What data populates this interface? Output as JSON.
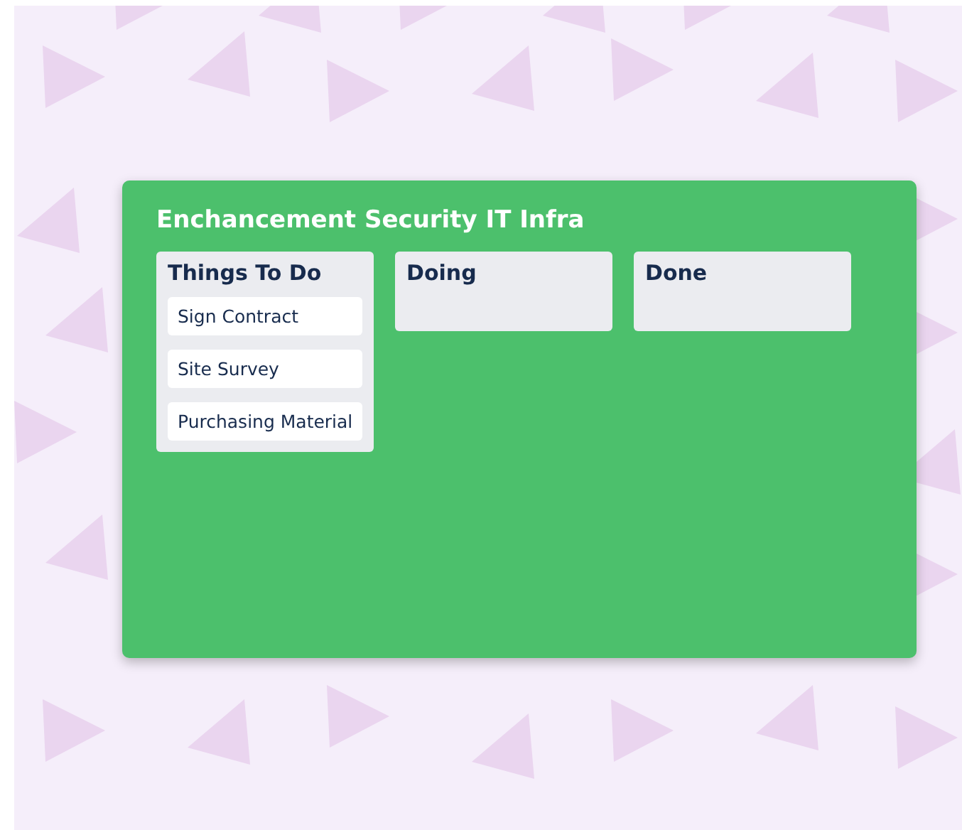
{
  "board": {
    "title": "Enchancement Security IT Infra",
    "lists": [
      {
        "title": "Things To Do",
        "cards": [
          "Sign Contract",
          "Site Survey",
          "Purchasing Material"
        ]
      },
      {
        "title": "Doing"
      },
      {
        "title": "Done"
      }
    ]
  }
}
